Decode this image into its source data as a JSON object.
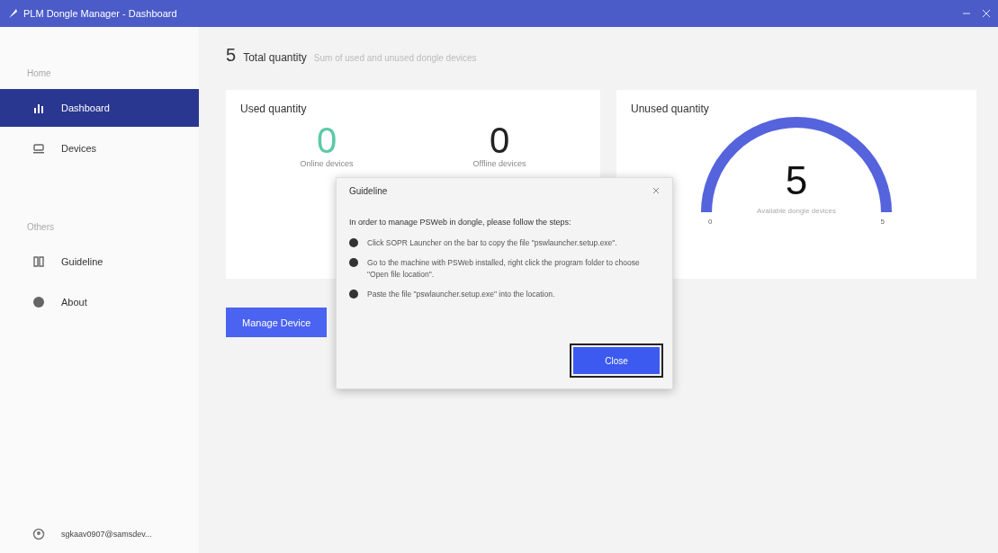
{
  "window": {
    "title": "PLM Dongle Manager - Dashboard"
  },
  "sidebar": {
    "sections": [
      {
        "label": "Home",
        "items": [
          {
            "label": "Dashboard",
            "selected": true
          },
          {
            "label": "Devices",
            "selected": false
          }
        ]
      },
      {
        "label": "Others",
        "items": [
          {
            "label": "Guideline",
            "selected": false
          },
          {
            "label": "About",
            "selected": false
          }
        ]
      }
    ],
    "account": "sgkaav0907@samsdev..."
  },
  "header": {
    "total": "5",
    "title": "Total quantity",
    "subtitle": "Sum of used and unused dongle devices"
  },
  "used_card": {
    "title": "Used quantity",
    "stats": [
      {
        "value": "0",
        "label": "Online devices",
        "kind": "online"
      },
      {
        "value": "0",
        "label": "Offline devices",
        "kind": "offline"
      }
    ]
  },
  "unused_card": {
    "title": "Unused quantity",
    "value": "5",
    "label": "Available dongle devices",
    "min": "0",
    "max": "5",
    "level": 1
  },
  "manage_button": "Manage Device",
  "dialog": {
    "title": "Guideline",
    "intro": "In order to manage PSWeb in dongle, please follow the steps:",
    "steps": [
      "Click SOPR Launcher on the bar to copy the file \"pswlauncher.setup.exe\".",
      "Go to the machine with PSWeb installed, right click the program folder to choose \"Open file location\".",
      "Paste the file \"pswlauncher.setup.exe\" into the location."
    ],
    "button": "Close"
  }
}
